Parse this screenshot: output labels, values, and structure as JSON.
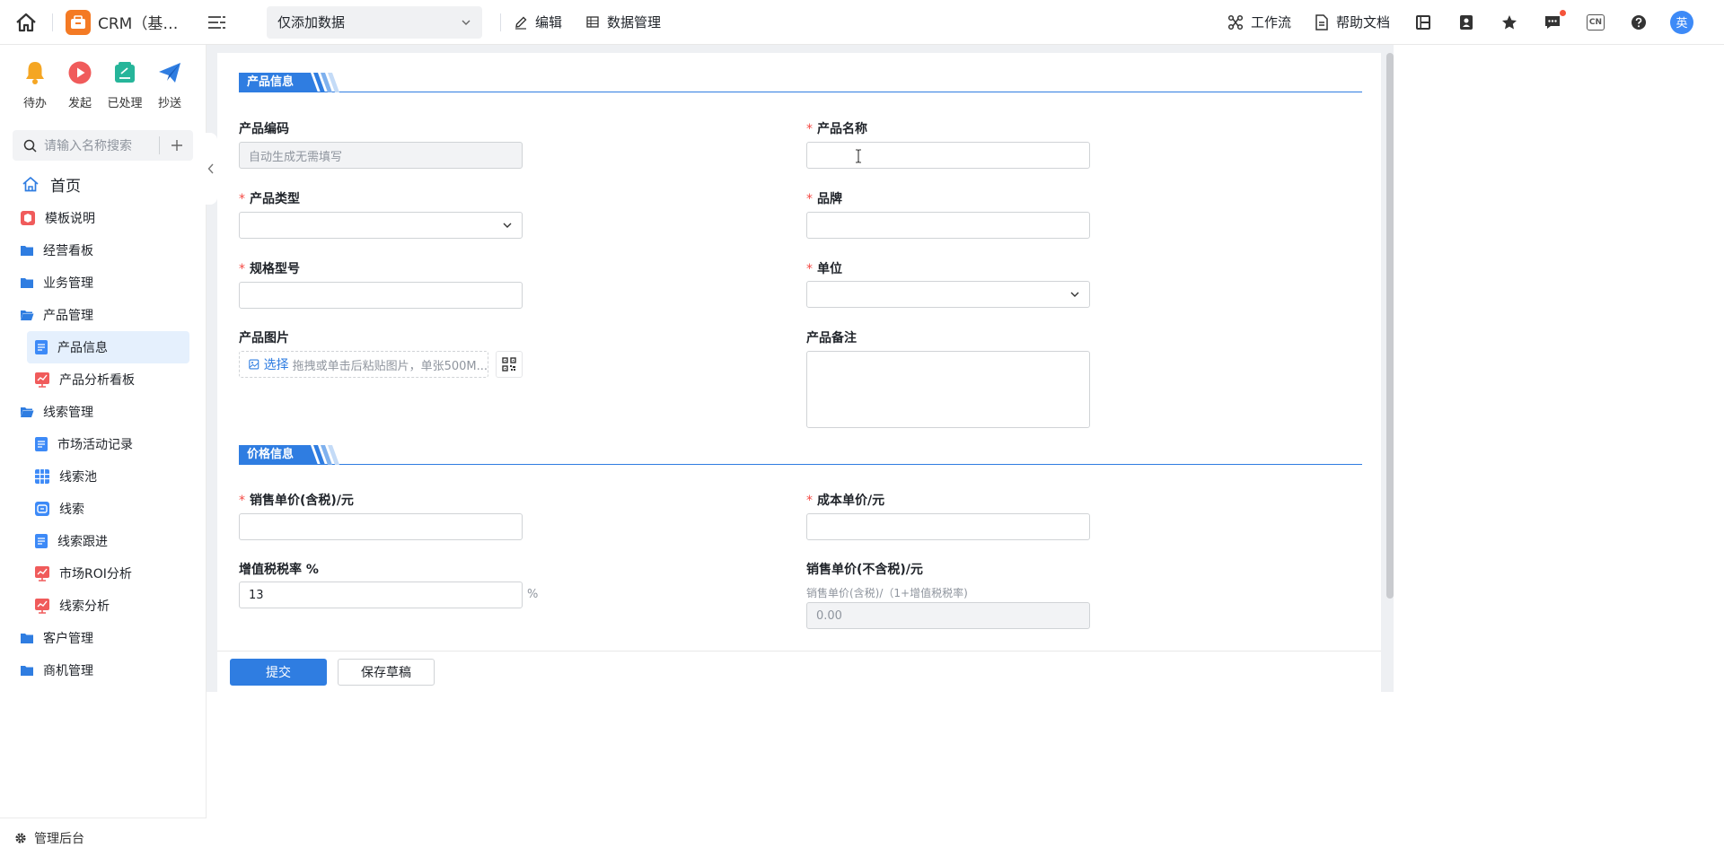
{
  "topbar": {
    "app_name": "CRM（基…",
    "view_select": "仅添加数据",
    "edit_label": "编辑",
    "data_manage_label": "数据管理",
    "workflow_label": "工作流",
    "help_doc_label": "帮助文档",
    "lang_box": "CN",
    "avatar_text": "英"
  },
  "sidebar": {
    "quick": [
      {
        "label": "待办",
        "icon": "bell-icon",
        "color": "#f5a623"
      },
      {
        "label": "发起",
        "icon": "play-icon",
        "color": "#f05b5b"
      },
      {
        "label": "已处理",
        "icon": "done-icon",
        "color": "#26b59a"
      },
      {
        "label": "抄送",
        "icon": "send-icon",
        "color": "#2f7de1"
      }
    ],
    "search_placeholder": "请输入名称搜索",
    "home_label": "首页",
    "items": [
      {
        "label": "模板说明",
        "level": 1,
        "icon": "template-icon"
      },
      {
        "label": "经营看板",
        "level": 1,
        "icon": "folder-icon"
      },
      {
        "label": "业务管理",
        "level": 1,
        "icon": "folder-icon"
      },
      {
        "label": "产品管理",
        "level": 1,
        "icon": "folder-open-icon"
      },
      {
        "label": "产品信息",
        "level": 2,
        "icon": "form-icon",
        "active": true
      },
      {
        "label": "产品分析看板",
        "level": 2,
        "icon": "report-icon"
      },
      {
        "label": "线索管理",
        "level": 1,
        "icon": "folder-open-icon"
      },
      {
        "label": "市场活动记录",
        "level": 2,
        "icon": "form-icon"
      },
      {
        "label": "线索池",
        "level": 2,
        "icon": "table-icon"
      },
      {
        "label": "线索",
        "level": 2,
        "icon": "lead-icon"
      },
      {
        "label": "线索跟进",
        "level": 2,
        "icon": "form-icon"
      },
      {
        "label": "市场ROI分析",
        "level": 2,
        "icon": "report-icon"
      },
      {
        "label": "线索分析",
        "level": 2,
        "icon": "report-icon"
      },
      {
        "label": "客户管理",
        "level": 1,
        "icon": "folder-icon"
      },
      {
        "label": "商机管理",
        "level": 1,
        "icon": "folder-icon"
      }
    ],
    "footer_label": "管理后台"
  },
  "form": {
    "section_product": "产品信息",
    "section_price": "价格信息",
    "product_code_label": "产品编码",
    "product_code_placeholder": "自动生成无需填写",
    "product_name_label": "产品名称",
    "product_type_label": "产品类型",
    "brand_label": "品牌",
    "spec_label": "规格型号",
    "unit_label": "单位",
    "image_label": "产品图片",
    "image_pick": "选择",
    "image_hint": "拖拽或单击后粘贴图片，单张500M...",
    "remark_label": "产品备注",
    "sale_price_tax_label": "销售单价(含税)/元",
    "cost_price_label": "成本单价/元",
    "vat_rate_label": "增值税税率 %",
    "vat_rate_value": "13",
    "percent_suffix": "%",
    "sale_price_notax_label": "销售单价(不含税)/元",
    "sale_price_notax_hint": "销售单价(含税)/（1+增值税税率)",
    "sale_price_notax_value": "0.00"
  },
  "footer": {
    "submit": "提交",
    "save_draft": "保存草稿"
  }
}
